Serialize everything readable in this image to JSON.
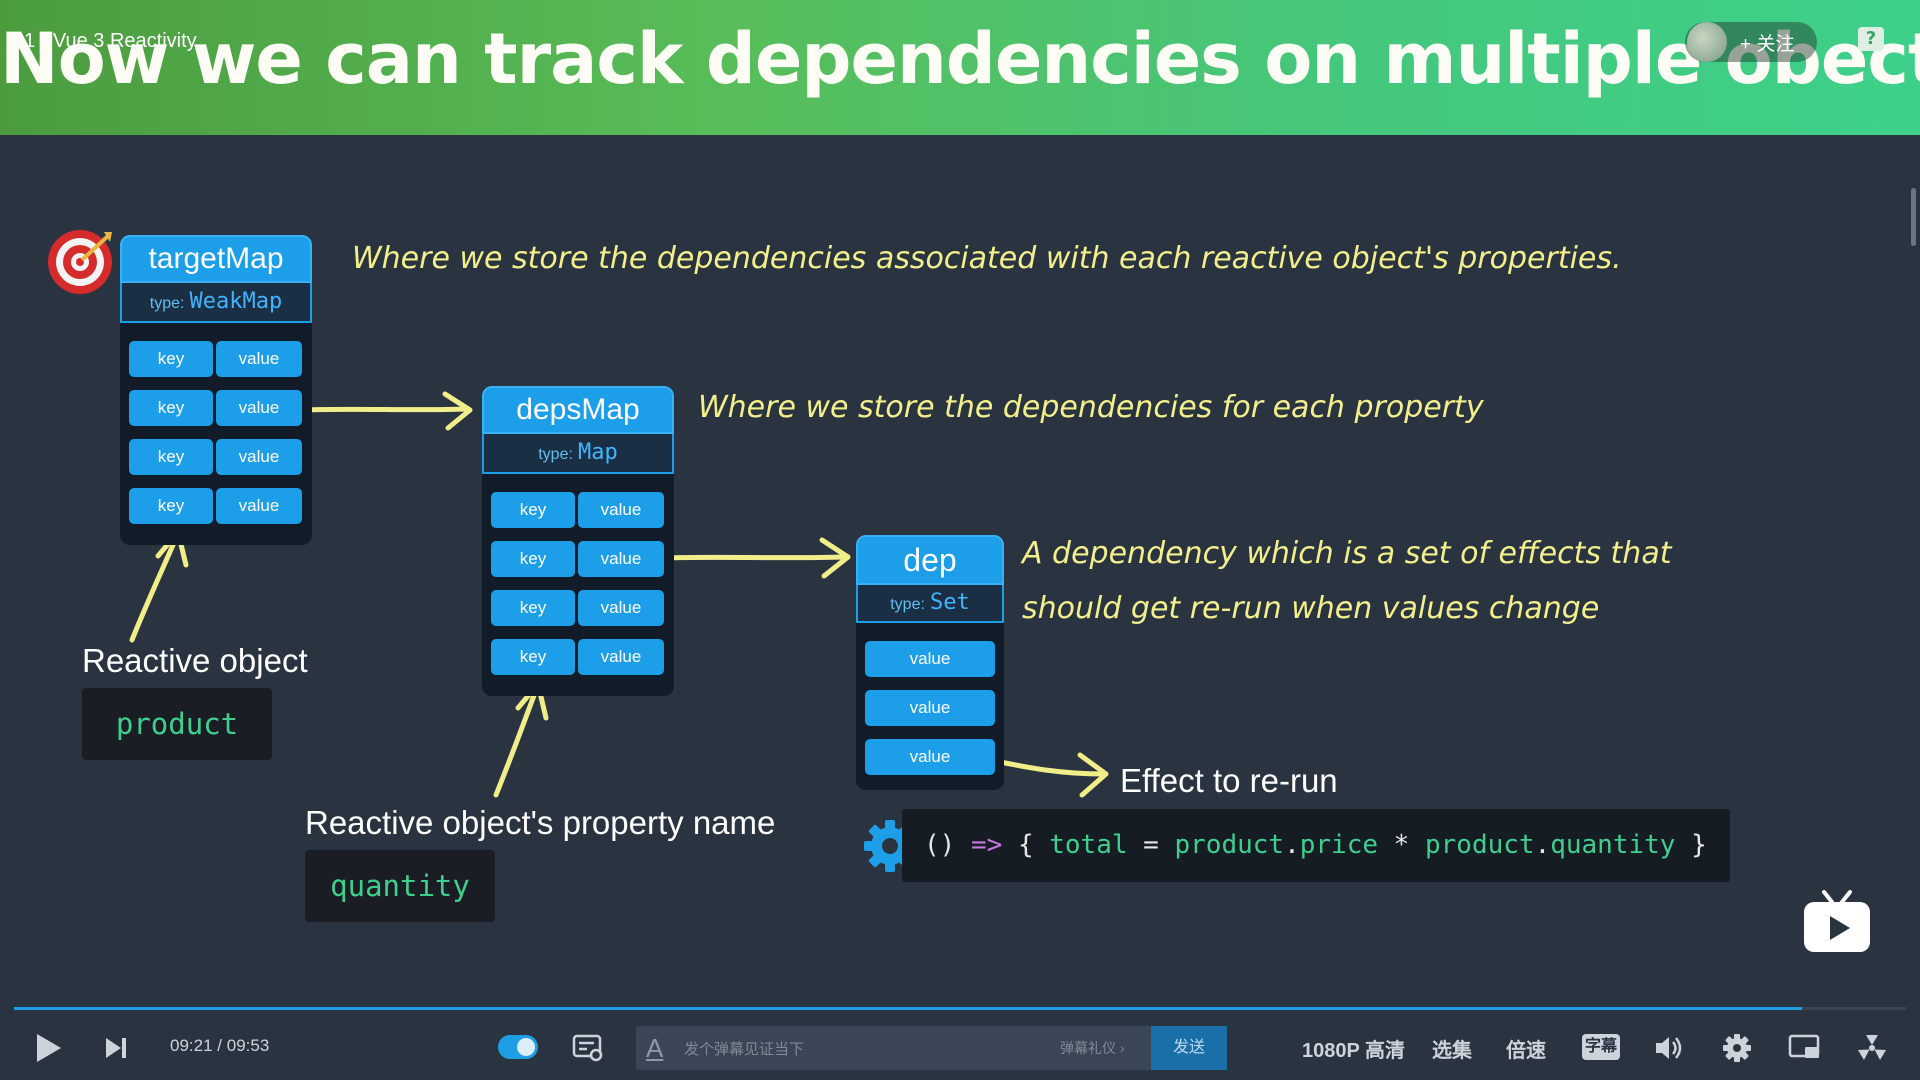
{
  "video": {
    "title": "1 - Vue 3 Reactivity",
    "follow_label": "+ 关注",
    "help_label": "?"
  },
  "slide": {
    "title": "Now we can track dependencies on multiple obects",
    "targetMap": {
      "name": "targetMap",
      "type_label": "type:",
      "type_value": "WeakMap",
      "rows": [
        {
          "key": "key",
          "value": "value"
        },
        {
          "key": "key",
          "value": "value"
        },
        {
          "key": "key",
          "value": "value"
        },
        {
          "key": "key",
          "value": "value"
        }
      ],
      "note": "Where we store the dependencies associated with each reactive object's properties."
    },
    "depsMap": {
      "name": "depsMap",
      "type_label": "type:",
      "type_value": "Map",
      "rows": [
        {
          "key": "key",
          "value": "value"
        },
        {
          "key": "key",
          "value": "value"
        },
        {
          "key": "key",
          "value": "value"
        },
        {
          "key": "key",
          "value": "value"
        }
      ],
      "note": "Where we store the dependencies for each property"
    },
    "dep": {
      "name": "dep",
      "type_label": "type:",
      "type_value": "Set",
      "values": [
        "value",
        "value",
        "value"
      ],
      "note_line1": "A dependency which is a set of effects that",
      "note_line2": "should get re-run when values change"
    },
    "reactive_object": {
      "label": "Reactive object",
      "code": "product"
    },
    "property_name": {
      "label": "Reactive object's property name",
      "code": "quantity"
    },
    "effect": {
      "label": "Effect to re-run",
      "code_parts": [
        "()",
        " => ",
        "{ ",
        "total",
        " = ",
        "product",
        ".",
        "price",
        " * ",
        "product",
        ".",
        "quantity",
        " }"
      ]
    }
  },
  "player": {
    "current_time": "09:21",
    "separator": "/",
    "duration": "09:53",
    "progress": 0.945,
    "danmaku_placeholder": "发个弹幕见证当下",
    "danmaku_etiquette": "弹幕礼仪 ›",
    "send_label": "发送",
    "quality": "1080P 高清",
    "episodes": "选集",
    "speed": "倍速",
    "subtitle": "字幕",
    "accent": "#1e9fe5"
  }
}
